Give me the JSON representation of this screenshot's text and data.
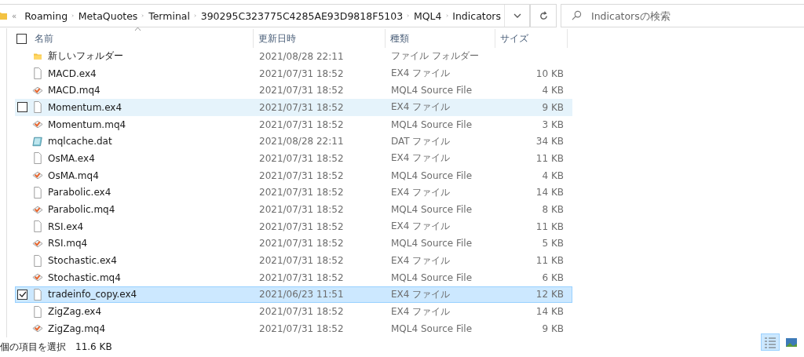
{
  "address_bar": {
    "overflow": "«",
    "crumbs": [
      "Roaming",
      "MetaQuotes",
      "Terminal",
      "390295C323775C4285AE93D9818F5103",
      "MQL4",
      "Indicators"
    ]
  },
  "search": {
    "placeholder": "Indicatorsの検索"
  },
  "table": {
    "select_all": {
      "checked": false
    },
    "columns": [
      "名前",
      "更新日時",
      "種類",
      "サイズ"
    ],
    "rows": [
      {
        "kind": "folder",
        "name": "新しいフォルダー",
        "modified": "2021/08/28 22:11",
        "type": "ファイル フォルダー",
        "size": "",
        "selected": false,
        "hovered": false
      },
      {
        "kind": "ex4",
        "name": "MACD.ex4",
        "modified": "2021/07/31 18:52",
        "type": "EX4 ファイル",
        "size": "10 KB",
        "selected": false,
        "hovered": false
      },
      {
        "kind": "mq4",
        "name": "MACD.mq4",
        "modified": "2021/07/31 18:52",
        "type": "MQL4 Source File",
        "size": "4 KB",
        "selected": false,
        "hovered": false
      },
      {
        "kind": "ex4",
        "name": "Momentum.ex4",
        "modified": "2021/07/31 18:52",
        "type": "EX4 ファイル",
        "size": "9 KB",
        "selected": false,
        "hovered": true
      },
      {
        "kind": "mq4",
        "name": "Momentum.mq4",
        "modified": "2021/07/31 18:52",
        "type": "MQL4 Source File",
        "size": "3 KB",
        "selected": false,
        "hovered": false
      },
      {
        "kind": "dat",
        "name": "mqlcache.dat",
        "modified": "2021/08/28 22:11",
        "type": "DAT ファイル",
        "size": "34 KB",
        "selected": false,
        "hovered": false
      },
      {
        "kind": "ex4",
        "name": "OsMA.ex4",
        "modified": "2021/07/31 18:52",
        "type": "EX4 ファイル",
        "size": "11 KB",
        "selected": false,
        "hovered": false
      },
      {
        "kind": "mq4",
        "name": "OsMA.mq4",
        "modified": "2021/07/31 18:52",
        "type": "MQL4 Source File",
        "size": "4 KB",
        "selected": false,
        "hovered": false
      },
      {
        "kind": "ex4",
        "name": "Parabolic.ex4",
        "modified": "2021/07/31 18:52",
        "type": "EX4 ファイル",
        "size": "14 KB",
        "selected": false,
        "hovered": false
      },
      {
        "kind": "mq4",
        "name": "Parabolic.mq4",
        "modified": "2021/07/31 18:52",
        "type": "MQL4 Source File",
        "size": "8 KB",
        "selected": false,
        "hovered": false
      },
      {
        "kind": "ex4",
        "name": "RSI.ex4",
        "modified": "2021/07/31 18:52",
        "type": "EX4 ファイル",
        "size": "11 KB",
        "selected": false,
        "hovered": false
      },
      {
        "kind": "mq4",
        "name": "RSI.mq4",
        "modified": "2021/07/31 18:52",
        "type": "MQL4 Source File",
        "size": "5 KB",
        "selected": false,
        "hovered": false
      },
      {
        "kind": "ex4",
        "name": "Stochastic.ex4",
        "modified": "2021/07/31 18:52",
        "type": "EX4 ファイル",
        "size": "11 KB",
        "selected": false,
        "hovered": false
      },
      {
        "kind": "mq4",
        "name": "Stochastic.mq4",
        "modified": "2021/07/31 18:52",
        "type": "MQL4 Source File",
        "size": "6 KB",
        "selected": false,
        "hovered": false
      },
      {
        "kind": "ex4",
        "name": "tradeinfo_copy.ex4",
        "modified": "2021/06/23 11:51",
        "type": "EX4 ファイル",
        "size": "12 KB",
        "selected": true,
        "hovered": false
      },
      {
        "kind": "ex4",
        "name": "ZigZag.ex4",
        "modified": "2021/07/31 18:52",
        "type": "EX4 ファイル",
        "size": "14 KB",
        "selected": false,
        "hovered": false
      },
      {
        "kind": "mq4",
        "name": "ZigZag.mq4",
        "modified": "2021/07/31 18:52",
        "type": "MQL4 Source File",
        "size": "9 KB",
        "selected": false,
        "hovered": false
      }
    ]
  },
  "status_bar": {
    "selection": "個の項目を選択",
    "selection_size": "11.6 KB",
    "views": [
      {
        "kind": "details",
        "selected": true
      },
      {
        "kind": "large_icons",
        "selected": false
      }
    ]
  }
}
